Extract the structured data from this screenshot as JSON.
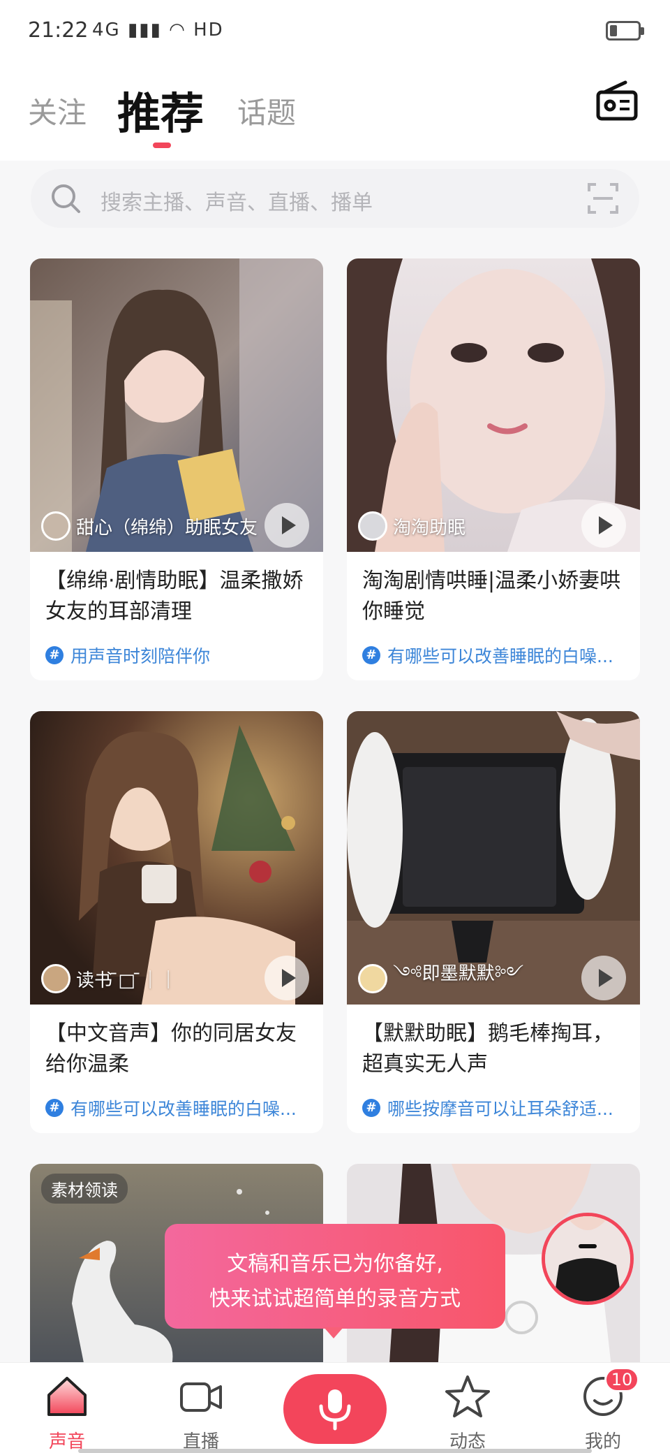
{
  "status_bar": {
    "time": "21:22",
    "network": "4G",
    "wifi_label": "HD",
    "battery_level": 0.25
  },
  "header": {
    "tabs": [
      {
        "label": "关注",
        "active": false
      },
      {
        "label": "推荐",
        "active": true
      },
      {
        "label": "话题",
        "active": false
      }
    ],
    "radio_icon": "radio-icon"
  },
  "search": {
    "placeholder": "搜索主播、声音、直播、播单",
    "icon": "search-icon",
    "scan_icon": "scan-icon"
  },
  "cards": [
    {
      "author": "甜心（绵绵）助眠女友",
      "title": "【绵绵·剧情助眠】温柔撒娇女友的耳部清理",
      "topic": "用声音时刻陪伴你"
    },
    {
      "author": "淘淘助眠",
      "title": "淘淘剧情哄睡|温柔小娇妻哄你睡觉",
      "topic": "有哪些可以改善睡眠的白噪..."
    },
    {
      "author": "读书 ̄□ ̄｜｜",
      "title": "【中文音声】你的同居女友给你温柔",
      "topic": "有哪些可以改善睡眠的白噪..."
    },
    {
      "author": "༺即墨默默༻",
      "title": "【默默助眠】鹅毛棒掏耳，超真实无人声",
      "topic": "哪些按摩音可以让耳朵舒适..."
    },
    {
      "tag": "素材领读"
    }
  ],
  "toast": {
    "line1": "文稿和音乐已为你备好,",
    "line2": "快来试试超简单的录音方式"
  },
  "bottom_nav": {
    "items": [
      {
        "label": "声音",
        "icon": "home-icon",
        "active": true
      },
      {
        "label": "直播",
        "icon": "video-camera-icon",
        "active": false
      },
      {
        "label": "",
        "icon": "microphone-icon",
        "active": false
      },
      {
        "label": "动态",
        "icon": "star-icon",
        "active": false
      },
      {
        "label": "我的",
        "icon": "profile-icon",
        "active": false
      }
    ],
    "profile_badge": "10"
  },
  "colors": {
    "accent": "#f2465a",
    "topic_blue": "#3d86d8",
    "background": "#f7f7f8"
  }
}
